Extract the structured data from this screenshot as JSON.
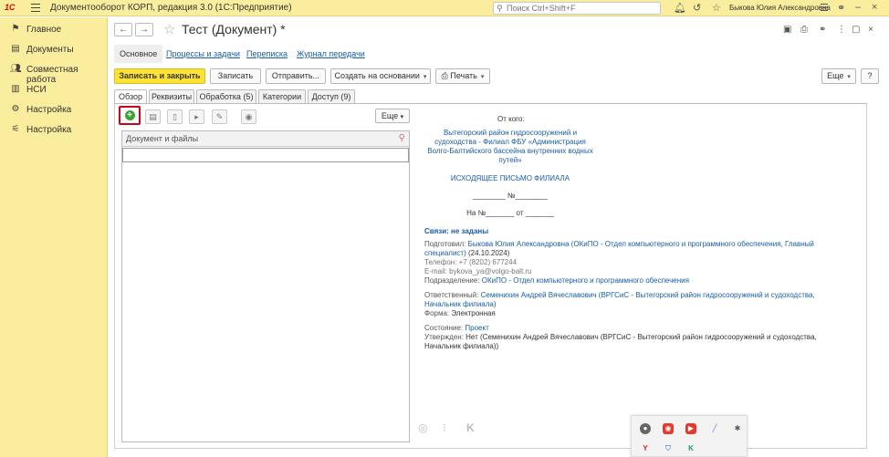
{
  "topbar": {
    "logo_text": "1С",
    "app_title": "Документооборот КОРП, редакция 3.0  (1С:Предприятие)",
    "search_placeholder": "Поиск Ctrl+Shift+F",
    "user_name": "Быкова Юлия Александровна"
  },
  "sidebar": {
    "items": [
      {
        "label": "Главное",
        "icon": "flag-icon"
      },
      {
        "label": "Документы",
        "icon": "documents-icon"
      },
      {
        "label": "Совместная работа",
        "icon": "people-icon"
      },
      {
        "label": "НСИ",
        "icon": "book-icon"
      },
      {
        "label": "Настройка",
        "icon": "gear-icon"
      },
      {
        "label": "Настройка",
        "icon": "sliders-icon"
      }
    ]
  },
  "header": {
    "doc_title": "Тест (Документ) *"
  },
  "section_tabs": [
    "Основное",
    "Процессы и задачи",
    "Переписка",
    "Журнал передачи"
  ],
  "toolbar": {
    "save_close": "Записать и закрыть",
    "save": "Записать",
    "send": "Отправить...",
    "create_based": "Создать на основании",
    "print": "Печать",
    "more": "Еще",
    "help": "?"
  },
  "tabs": [
    "Обзор",
    "Реквизиты",
    "Обработка (5)",
    "Категории",
    "Доступ (9)"
  ],
  "files": {
    "more": "Еще",
    "column_header": "Документ и файлы"
  },
  "preview": {
    "from_label": "От кого:",
    "org_lines": [
      "Вытегорский район гидросооружений и",
      "судоходства - Филиал ФБУ «Администрация",
      "Волго-Балтийского бассейна внутренних водных",
      "путей»"
    ],
    "letter_type": "ИСХОДЯЩЕЕ ПИСЬМО ФИЛИАЛА",
    "number_line": "________ №________",
    "reply_line": "На №_______ от _______",
    "links_title": "Связи: не заданы",
    "prepared_label": "Подготовил:",
    "prepared_value": "Быкова Юлия Александровна (ОКиПО - Отдел компьютерного и программного обеспечения, Главный",
    "prepared_value2": "специалист)",
    "prepared_date": "(24.10.2024)",
    "phone": "Телефон: +7 (8202) 677244",
    "email": "E-mail: bykova_ya@volgo-balt.ru",
    "dept_label": "Подразделение:",
    "dept_value": "ОКиПО - Отдел компьютерного и программного обеспечения",
    "resp_label": "Ответственный:",
    "resp_value": "Семенихин Андрей Вячеславович (ВРГСиС - Вытегорский район гидросооружений и судоходства,",
    "resp_value2": "Начальник филиала)",
    "form_label": "Форма:",
    "form_value": "Электронная",
    "state_label": "Состояние:",
    "state_value": "Проект",
    "approved_label": "Утвержден:",
    "approved_value": "Нет (Семенихин Андрей Вячеславович (ВРГСиС - Вытегорский район гидросооружений и судоходства,",
    "approved_value2": "Начальник филиала))"
  },
  "colors": {
    "sidebar_bg": "#fbed9e",
    "primary_button": "#fde232",
    "link": "#1a5ea5",
    "highlight_border": "#d0021b"
  }
}
